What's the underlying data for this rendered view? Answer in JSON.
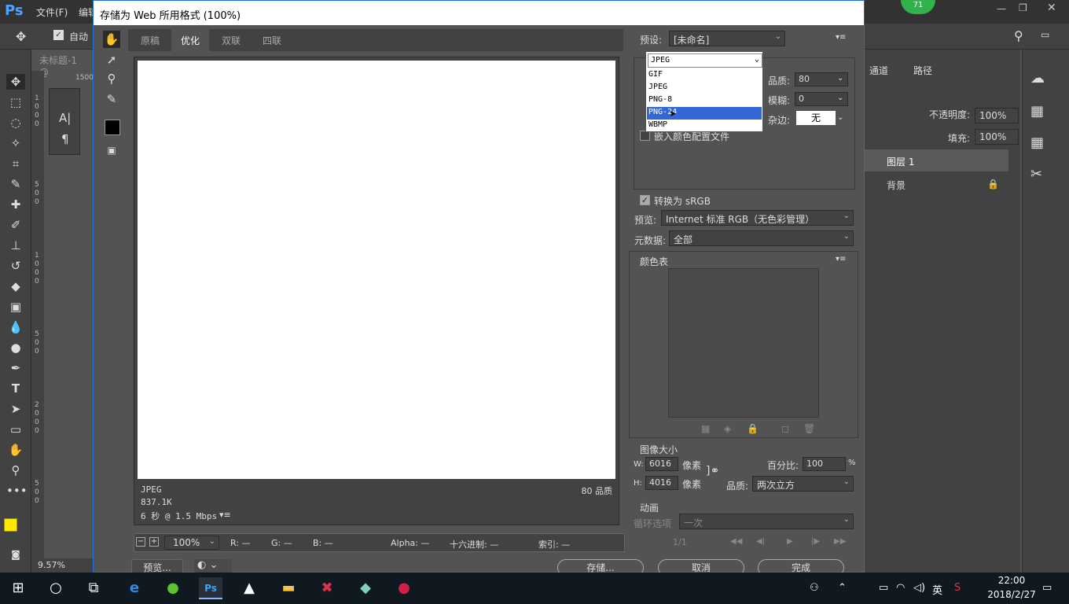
{
  "ps": {
    "logo": "Ps",
    "menu": [
      "文件(F)",
      "编辑"
    ],
    "options_autoselect": "自动",
    "doc_tab": "未标题-1 @",
    "ruler_mark": "1500",
    "zoom_status": "9.57%",
    "badge": "71",
    "right_panel": {
      "tabs": [
        "通道",
        "路径"
      ],
      "opacity_label": "不透明度:",
      "opacity_value": "100%",
      "fill_label": "填充:",
      "fill_value": "100%",
      "layers": [
        "图层 1",
        "背景"
      ]
    }
  },
  "dialog": {
    "title": "存储为 Web 所用格式 (100%)",
    "tabs": [
      "原稿",
      "优化",
      "双联",
      "四联"
    ],
    "active_tab": "优化",
    "image_info": {
      "format": "JPEG",
      "size": "837.1K",
      "speed": "6 秒 @ 1.5 Mbps",
      "quality": "80 品质"
    },
    "bottom": {
      "zoom": "100%",
      "r": "R: —",
      "g": "G: —",
      "b": "B: —",
      "alpha": "Alpha: —",
      "hex": "十六进制: —",
      "index": "索引: —"
    },
    "buttons": {
      "preview": "预览...",
      "save": "存储...",
      "cancel": "取消",
      "done": "完成"
    },
    "preset_label": "预设:",
    "preset_value": "[未命名]",
    "format_value": "JPEG",
    "format_options": [
      "GIF",
      "JPEG",
      "PNG-8",
      "PNG-24",
      "WBMP"
    ],
    "format_selected": "PNG-24",
    "quality_label": "品质:",
    "quality_value": "80",
    "blur_label": "模糊:",
    "blur_value": "0",
    "matte_label": "杂边:",
    "matte_value": "无",
    "embed_profile": "嵌入颜色配置文件",
    "convert_srgb": "转换为 sRGB",
    "preview_label": "预览:",
    "preview_value": "Internet 标准 RGB（无色彩管理）",
    "metadata_label": "元数据:",
    "metadata_value": "全部",
    "color_table": "颜色表",
    "image_size": {
      "title": "图像大小",
      "w_label": "W:",
      "w_value": "6016",
      "h_label": "H:",
      "h_value": "4016",
      "unit": "像素",
      "percent_label": "百分比:",
      "percent_value": "100",
      "percent_sign": "%",
      "quality_label": "品质:",
      "quality_value": "两次立方"
    },
    "animation": {
      "title": "动画",
      "loop_label": "循环选项",
      "loop_value": "一次",
      "frame": "1/1"
    }
  },
  "taskbar": {
    "ime": "英",
    "time": "22:00",
    "date": "2018/2/27"
  }
}
